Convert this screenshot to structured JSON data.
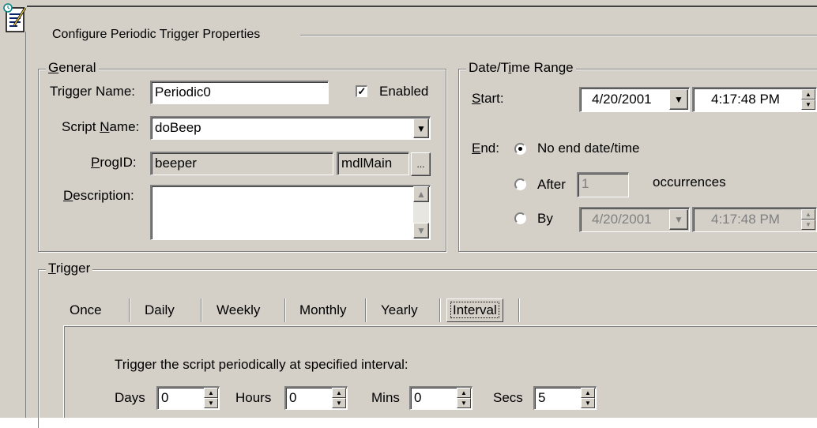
{
  "dialog": {
    "title": "Configure Periodic Trigger Properties"
  },
  "icon": {
    "name": "document-pen-icon"
  },
  "general": {
    "legend": "General",
    "trigger_name_label": "Trigger Name:",
    "trigger_name_value": "Periodic0",
    "enabled_label": "Enabled",
    "enabled_checked": true,
    "script_name_label": "Script Name:",
    "script_name_value": "doBeep",
    "progid_label": "ProgID:",
    "progid_value": "beeper",
    "progid_module": "mdlMain",
    "browse_label": "...",
    "description_label": "Description:",
    "description_value": ""
  },
  "date_time_range": {
    "legend": "Date/Time Range",
    "start_label": "Start:",
    "start_date": "4/20/2001",
    "start_time": "4:17:48 PM",
    "end_label": "End:",
    "no_end_label": "No end date/time",
    "after_label": "After",
    "after_value": "1",
    "occurrences_label": "occurrences",
    "by_label": "By",
    "by_date": "4/20/2001",
    "by_time": "4:17:48 PM",
    "selected_end_option": "No end date/time"
  },
  "trigger": {
    "legend": "Trigger",
    "tabs": [
      "Once",
      "Daily",
      "Weekly",
      "Monthly",
      "Yearly",
      "Interval"
    ],
    "active_tab": "Interval",
    "interval_description": "Trigger the script periodically at specified interval:",
    "days_label": "Days",
    "days_value": "0",
    "hours_label": "Hours",
    "hours_value": "0",
    "mins_label": "Mins",
    "mins_value": "0",
    "secs_label": "Secs",
    "secs_value": "5"
  },
  "colors": {
    "face": "#d4d0c8",
    "shadow": "#808080",
    "highlight": "#ffffff",
    "dark": "#404040",
    "accent_icon": "#0a246a"
  }
}
